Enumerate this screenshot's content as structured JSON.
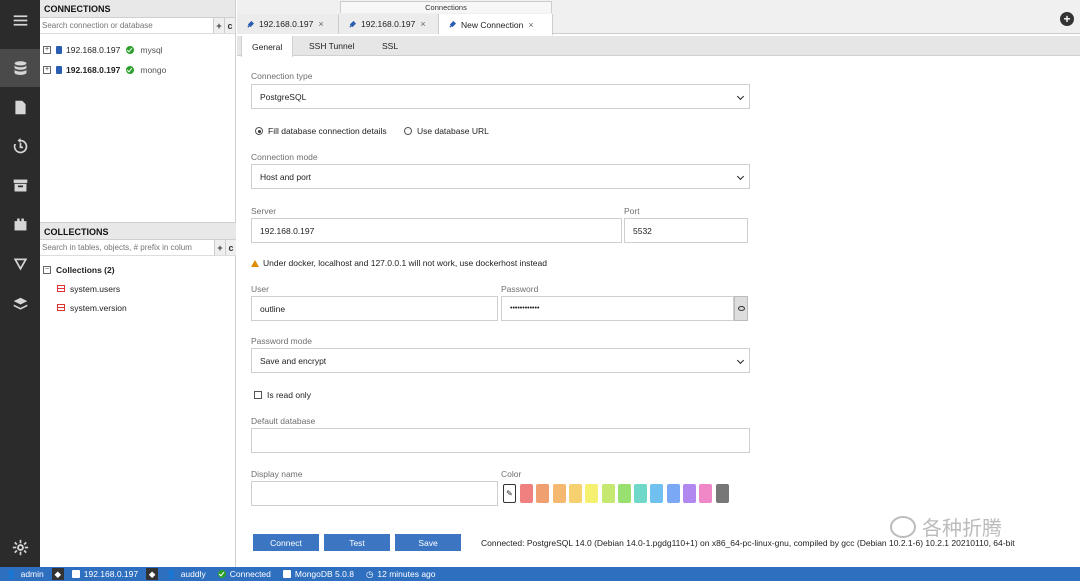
{
  "sidebar": {
    "icons": [
      "menu-icon",
      "database-icon",
      "file-icon",
      "history-icon",
      "archive-icon",
      "plugin-icon",
      "filter-icon",
      "layers-icon",
      "settings-icon"
    ]
  },
  "connections": {
    "header": "CONNECTIONS",
    "search_placeholder": "Search connection or database",
    "add_label": "+",
    "refresh_label": "c",
    "items": [
      {
        "host": "192.168.0.197",
        "driver": "mysql"
      },
      {
        "host": "192.168.0.197",
        "driver": "mongo"
      }
    ]
  },
  "collections": {
    "header": "COLLECTIONS",
    "search_placeholder": "Search in tables, objects, # prefix in colum",
    "add_label": "+",
    "refresh_label": "c",
    "group": "Collections (2)",
    "items": [
      "system.users",
      "system.version"
    ]
  },
  "tabs": {
    "group_label": "Connections",
    "items": [
      {
        "label": "192.168.0.197"
      },
      {
        "label": "192.168.0.197"
      },
      {
        "label": "New Connection"
      }
    ],
    "close": "×",
    "add": "+"
  },
  "subtabs": [
    "General",
    "SSH Tunnel",
    "SSL"
  ],
  "form": {
    "connection_type_label": "Connection type",
    "connection_type_value": "PostgreSQL",
    "radio_fill": "Fill database connection details",
    "radio_url": "Use database URL",
    "connection_mode_label": "Connection mode",
    "connection_mode_value": "Host and port",
    "server_label": "Server",
    "server_value": "192.168.0.197",
    "port_label": "Port",
    "port_value": "5532",
    "warning": "Under docker, localhost and 127.0.0.1 will not work, use dockerhost instead",
    "user_label": "User",
    "user_value": "outline",
    "password_label": "Password",
    "password_value": "••••••••••••",
    "password_mode_label": "Password mode",
    "password_mode_value": "Save and encrypt",
    "readonly_label": "Is read only",
    "default_db_label": "Default database",
    "default_db_value": "",
    "display_name_label": "Display name",
    "display_name_value": "",
    "color_label": "Color",
    "colors": [
      "#f08080",
      "#f0a070",
      "#f5b870",
      "#f7d070",
      "#f5f070",
      "#c5e870",
      "#98e070",
      "#70d8c8",
      "#70c0f0",
      "#7aa8f5",
      "#b088f0",
      "#f088c8",
      "#777777"
    ]
  },
  "buttons": {
    "connect": "Connect",
    "test": "Test",
    "save": "Save"
  },
  "status_message": "Connected: PostgreSQL 14.0 (Debian 14.0-1.pgdg110+1) on x86_64-pc-linux-gnu, compiled by gcc (Debian 10.2.1-6) 10.2.1 20210110, 64-bit",
  "watermark": "各种折腾",
  "statusbar": {
    "user": "admin",
    "connection": "192.168.0.197",
    "db_user": "auddly",
    "state": "Connected",
    "version": "MongoDB 5.0.8",
    "time": "12 minutes ago"
  }
}
